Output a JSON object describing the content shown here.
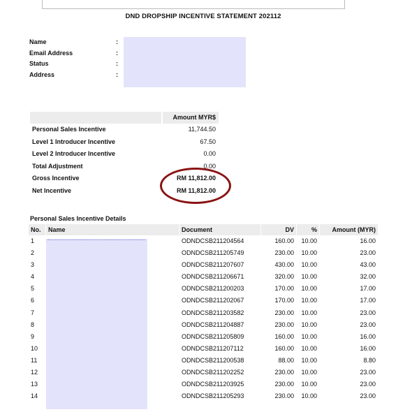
{
  "title": "DND DROPSHIP INCENTIVE STATEMENT 202112",
  "info": [
    {
      "label": "Name",
      "colon": ":"
    },
    {
      "label": "Email Address",
      "colon": ":"
    },
    {
      "label": "Status",
      "colon": ":"
    },
    {
      "label": "Address",
      "colon": ":"
    }
  ],
  "summary": {
    "header": "Amount MYR$",
    "rows": [
      {
        "label": "Personal Sales Incentive",
        "value": "11,744.50"
      },
      {
        "label": "Level 1 Introducer Incentive",
        "value": "67.50"
      },
      {
        "label": "Level 2 Introducer Incentive",
        "value": "0.00"
      },
      {
        "label": "Total Adjustment",
        "value": "0.00"
      },
      {
        "label": "Gross Incentive",
        "value": "RM 11,812.00"
      },
      {
        "label": "Net Incentive",
        "value": "RM 11,812.00"
      }
    ]
  },
  "details": {
    "title": "Personal Sales Incentive Details",
    "headers": {
      "no": "No.",
      "name": "Name",
      "document": "Document",
      "dv": "DV",
      "pct": "%",
      "amount": "Amount (MYR)"
    },
    "rows": [
      {
        "no": "1",
        "document": "ODNDCSB211204564",
        "dv": "160.00",
        "pct": "10.00",
        "amount": "16.00"
      },
      {
        "no": "2",
        "document": "ODNDCSB211205749",
        "dv": "230.00",
        "pct": "10.00",
        "amount": "23.00"
      },
      {
        "no": "3",
        "document": "ODNDCSB211207607",
        "dv": "430.00",
        "pct": "10.00",
        "amount": "43.00"
      },
      {
        "no": "4",
        "document": "ODNDCSB211206671",
        "dv": "320.00",
        "pct": "10.00",
        "amount": "32.00"
      },
      {
        "no": "5",
        "document": "ODNDCSB211200203",
        "dv": "170.00",
        "pct": "10.00",
        "amount": "17.00"
      },
      {
        "no": "6",
        "document": "ODNDCSB211202067",
        "dv": "170.00",
        "pct": "10.00",
        "amount": "17.00"
      },
      {
        "no": "7",
        "document": "ODNDCSB211203582",
        "dv": "230.00",
        "pct": "10.00",
        "amount": "23.00"
      },
      {
        "no": "8",
        "document": "ODNDCSB211204887",
        "dv": "230.00",
        "pct": "10.00",
        "amount": "23.00"
      },
      {
        "no": "9",
        "document": "ODNDCSB211205809",
        "dv": "160.00",
        "pct": "10.00",
        "amount": "16.00"
      },
      {
        "no": "10",
        "document": "ODNDCSB211207112",
        "dv": "160.00",
        "pct": "10.00",
        "amount": "16.00"
      },
      {
        "no": "11",
        "document": "ODNDCSB211200538",
        "dv": "88.00",
        "pct": "10.00",
        "amount": "8.80"
      },
      {
        "no": "12",
        "document": "ODNDCSB211202252",
        "dv": "230.00",
        "pct": "10.00",
        "amount": "23.00"
      },
      {
        "no": "13",
        "document": "ODNDCSB211203925",
        "dv": "230.00",
        "pct": "10.00",
        "amount": "23.00"
      },
      {
        "no": "14",
        "document": "ODNDCSB211205293",
        "dv": "230.00",
        "pct": "10.00",
        "amount": "23.00"
      }
    ]
  },
  "colors": {
    "redaction": "#e3e3fb",
    "highlight_ellipse": "#8a1414",
    "header_bg": "#ececec"
  }
}
